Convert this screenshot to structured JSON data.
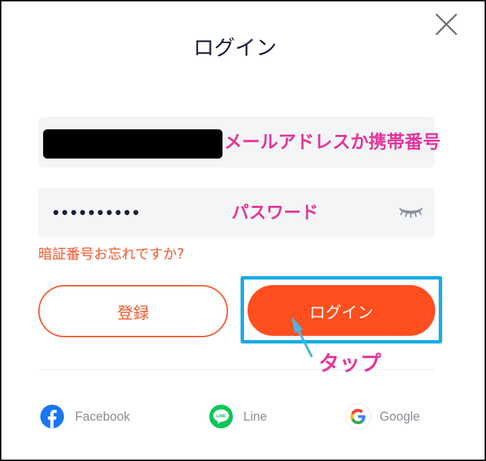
{
  "dialog": {
    "title": "ログイン",
    "close_icon": "close-icon"
  },
  "password_field": {
    "masked_value": "••••••••••",
    "visibility_icon": "eye-closed-icon"
  },
  "forgot_link": {
    "label": "暗証番号お忘れですか?"
  },
  "buttons": {
    "register_label": "登録",
    "login_label": "ログイン"
  },
  "annotations": {
    "account": "メールアドレスか携帯番号",
    "password": "パスワード",
    "tap": "タップ"
  },
  "social": [
    {
      "label": "Facebook",
      "icon": "facebook-icon"
    },
    {
      "label": "Line",
      "icon": "line-icon",
      "logo_text": "LINE"
    },
    {
      "label": "Google",
      "icon": "google-icon"
    }
  ],
  "colors": {
    "title": "#1c1f3a",
    "accent": "#ff4f1f",
    "link": "#f25a2e",
    "annotation_pink": "#e4359b",
    "annotation_highlight": "#1cabe6",
    "facebook": "#1877f2",
    "line": "#06c755"
  }
}
